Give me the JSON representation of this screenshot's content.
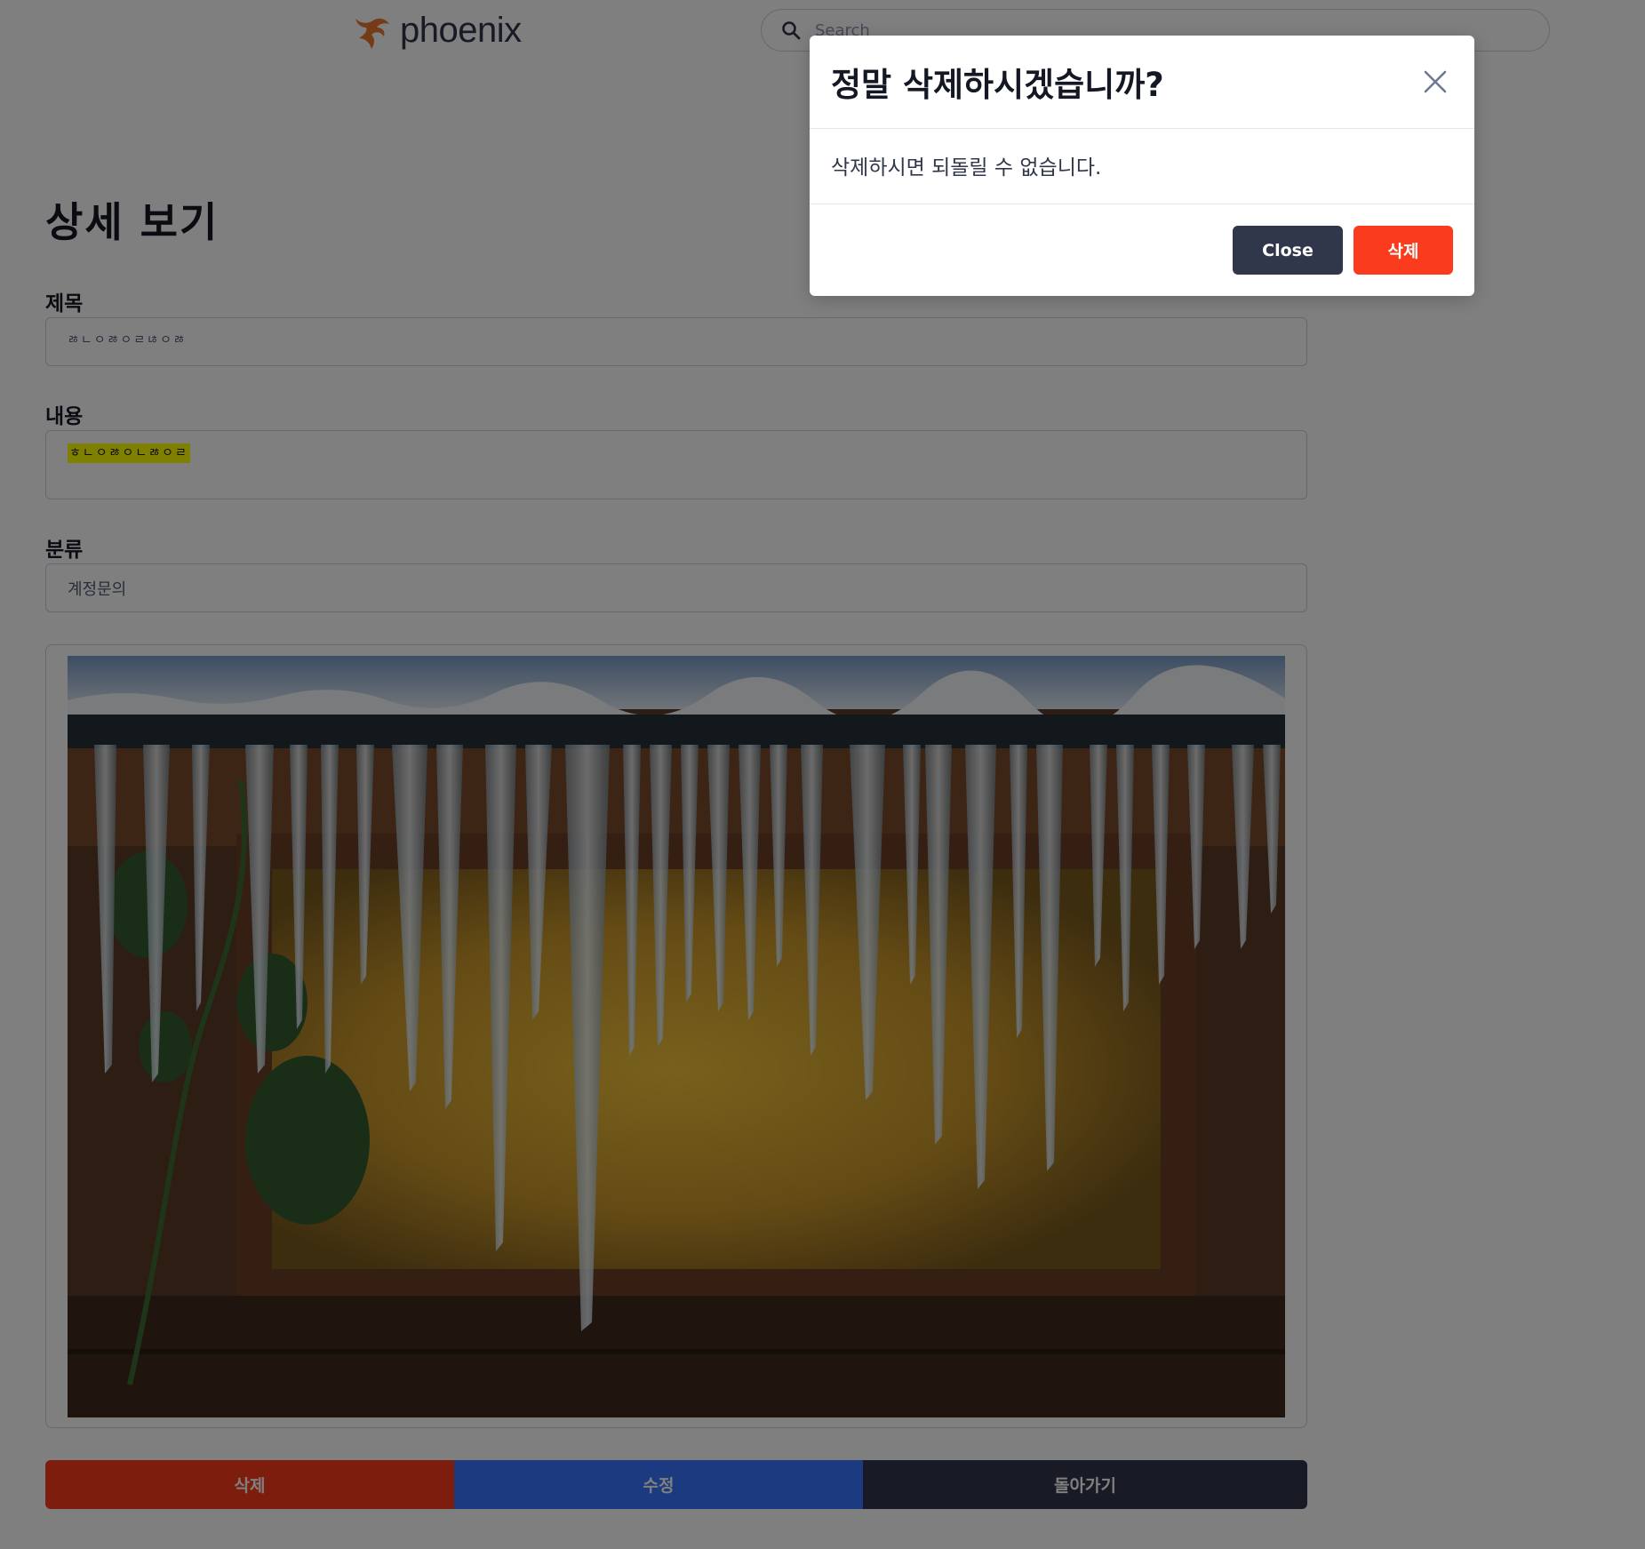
{
  "header": {
    "logo_text": "phoenix",
    "search_placeholder": "Search"
  },
  "page": {
    "title": "상세 보기",
    "fields": {
      "title_label": "제목",
      "title_value": "ㅀㄴㅇㅀㅇㄹㄶㅇㅀ",
      "content_label": "내용",
      "content_value": "ㅎㄴㅇㅀㅇㄴㅀㅇㄹ",
      "category_label": "분류",
      "category_value": "계정문의"
    },
    "actions": {
      "delete_label": "삭제",
      "edit_label": "수정",
      "back_label": "돌아가기"
    }
  },
  "modal": {
    "title": "정말 삭제하시겠습니까?",
    "body": "삭제하시면 되돌릴 수 없습니다.",
    "close_label": "Close",
    "confirm_label": "삭제"
  },
  "colors": {
    "accent_orange": "#e9772c",
    "danger": "#fa3b1d",
    "primary": "#3874ff",
    "dark": "#31374a",
    "highlight": "#ffff00"
  }
}
